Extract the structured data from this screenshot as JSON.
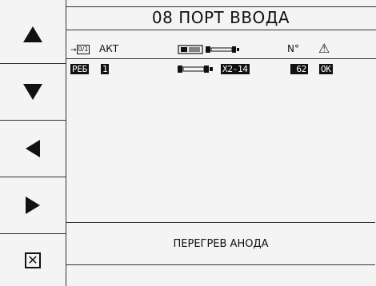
{
  "sidebar": {
    "buttons": [
      {
        "icon": "arrow-up-icon"
      },
      {
        "icon": "arrow-down-icon"
      },
      {
        "icon": "arrow-left-icon"
      },
      {
        "icon": "arrow-right-icon"
      },
      {
        "icon": "close-icon",
        "glyph": "✕"
      }
    ]
  },
  "title": "08 ПОРТ ВВОДА",
  "header": {
    "port_icon_text": "0/1",
    "col_act": "АКТ",
    "col_no": "N°",
    "warning_glyph": "⚠"
  },
  "rows": [
    {
      "code": "РЕБ",
      "act": "1",
      "port": "X2-14",
      "number": "62",
      "status": "OK"
    }
  ],
  "status_message": "ПЕРЕГРЕВ АНОДА"
}
